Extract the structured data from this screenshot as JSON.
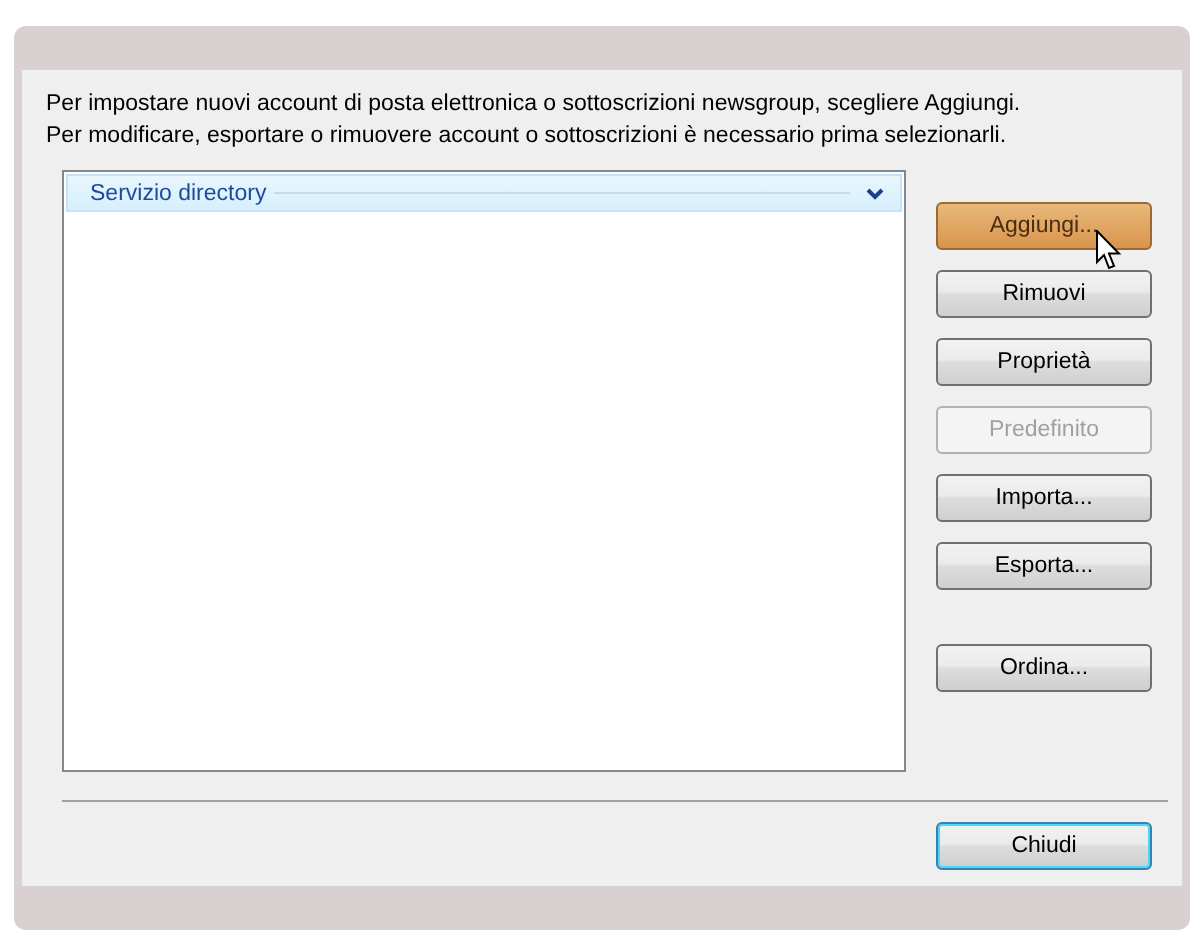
{
  "instructions": [
    "Per impostare nuovi account di posta elettronica o sottoscrizioni newsgroup, scegliere Aggiungi.",
    "Per modificare, esportare o rimuovere account o sottoscrizioni è necessario prima selezionarli."
  ],
  "list": {
    "groups": [
      {
        "label": "Servizio directory",
        "expanded": true
      }
    ]
  },
  "button_groups": [
    [
      {
        "label": "Aggiungi...",
        "hovered": true,
        "disabled": false
      },
      {
        "label": "Rimuovi",
        "hovered": false,
        "disabled": false
      },
      {
        "label": "Proprietà",
        "hovered": false,
        "disabled": false
      },
      {
        "label": "Predefinito",
        "hovered": false,
        "disabled": true
      },
      {
        "label": "Importa...",
        "hovered": false,
        "disabled": false
      },
      {
        "label": "Esporta...",
        "hovered": false,
        "disabled": false
      }
    ],
    [
      {
        "label": "Ordina...",
        "hovered": false,
        "disabled": false
      }
    ]
  ],
  "close_button": {
    "label": "Chiudi",
    "default": true
  }
}
